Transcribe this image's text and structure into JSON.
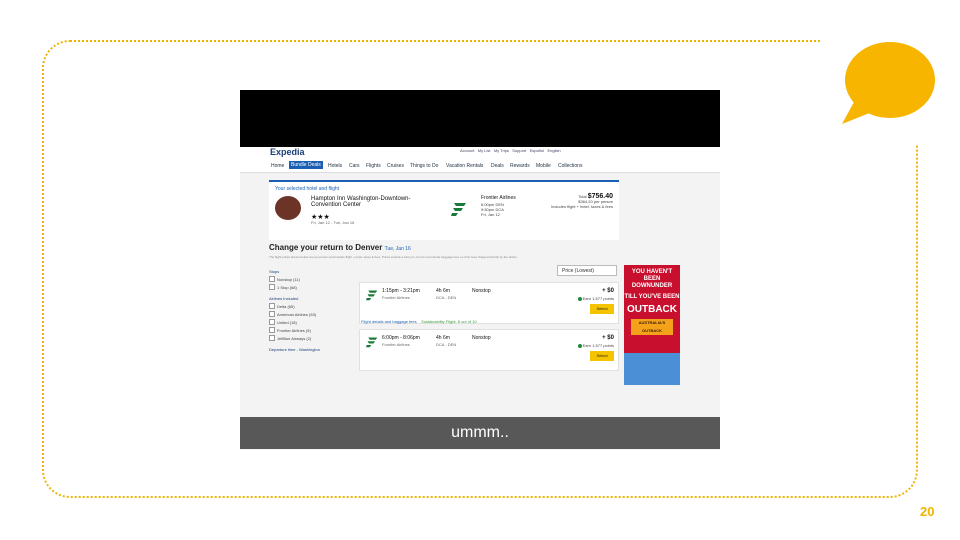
{
  "slide": {
    "number": "20",
    "accent_color": "#f0b400"
  },
  "caption": "ummm..",
  "expedia": {
    "logo": "Expedia",
    "top_links": [
      "Account",
      "My List",
      "My Trips",
      "Support",
      "Español",
      "English"
    ],
    "nav": [
      "Home",
      "Bundle Deals",
      "Hotels",
      "Cars",
      "Flights",
      "Cruises",
      "Things to Do",
      "Vacation Rentals",
      "Deals",
      "Rewards",
      "Mobile",
      "Collections"
    ],
    "selected": {
      "title": "Your selected hotel and flight",
      "hotel_name": "Hampton Inn Washington-Downtown-Convention Center",
      "stars": "★★★",
      "dates": "Fri, Jan 12 - Tue, Jan 16",
      "airline": "Frontier Airlines",
      "flight_detail_1": "6:00pm DEN",
      "flight_detail_2": "9:50pm DCA",
      "flight_date": "Fri, Jan 12",
      "total_label": "Total",
      "total": "$756.40",
      "per_person": "$364.20 per person",
      "includes": "Includes flight + hotel, taxes & fees"
    },
    "change_title": "Change your return to Denver",
    "change_date": "Tue, Jan 16",
    "disclaimer": "The flight prices shown below are per person and include flight + hotel, taxes & fees. Prices include a carry-on, but do not include baggage fees or other fees charged directly by the airline.",
    "sort_label": "Price (Lowest)",
    "filters": {
      "stops_header": "Stops",
      "stops": [
        "Nonstop (11)",
        "1 Stop (68)"
      ],
      "airlines_header": "Airlines Included",
      "airlines": [
        "Delta (65)",
        "American Airlines (53)",
        "United (18)",
        "Frontier Airlines (5)",
        "JetBlue Airways (2)"
      ],
      "departure_header": "Departure time - Washington"
    },
    "flights": [
      {
        "times": "1:15pm - 3:21pm",
        "airline": "Frontier Airlines",
        "duration": "4h 6m",
        "route": "DCA - DEN",
        "stops": "Nonstop",
        "price": "+ $0",
        "earn": "Earn 1,577 points",
        "select": "Select"
      },
      {
        "times": "6:00pm - 8:06pm",
        "airline": "Frontier Airlines",
        "duration": "4h 6m",
        "route": "DCA - DEN",
        "stops": "Nonstop",
        "price": "+ $0",
        "earn": "Earn 1,577 points",
        "select": "Select"
      }
    ],
    "flight_links": {
      "details": "Flight details and baggage fees",
      "sustainability": "Sustainability Flight: 8 out of 10"
    },
    "ad": {
      "line1": "YOU HAVEN'T BEEN DOWNUNDER",
      "line2": "TILL YOU'VE BEEN",
      "line3": "OUTBACK",
      "brand": "AUSTRALIA'S OUTBACK"
    },
    "colors": {
      "brand": "#1a3f7a",
      "nav_active": "#1a5fb4",
      "frontier": "#1a7a3a",
      "select_button": "#f5c400",
      "ad_red": "#c8102e"
    }
  }
}
